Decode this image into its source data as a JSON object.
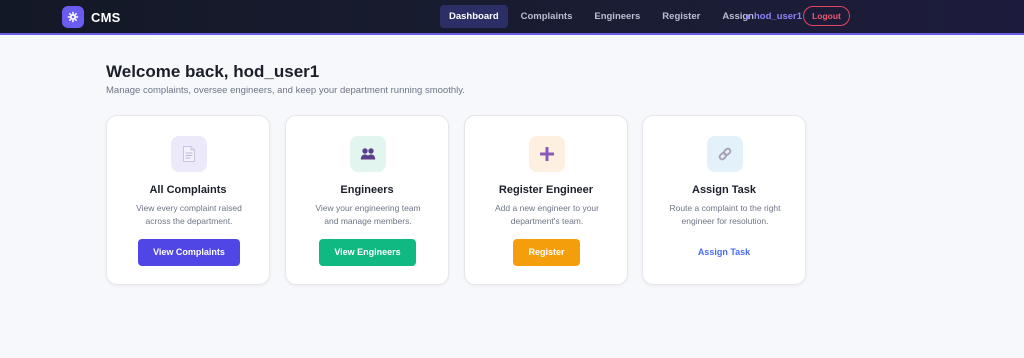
{
  "app": {
    "name": "CMS"
  },
  "nav": {
    "items": [
      {
        "label": "Dashboard"
      },
      {
        "label": "Complaints"
      },
      {
        "label": "Engineers"
      },
      {
        "label": "Register"
      },
      {
        "label": "Assign"
      }
    ],
    "active": "Dashboard",
    "user": "hod_user1",
    "logout_label": "Logout"
  },
  "header": {
    "title": "Welcome back, hod_user1",
    "subtitle": "Manage complaints, oversee engineers, and keep your department running smoothly."
  },
  "cards": [
    {
      "title": "All Complaints",
      "desc_line1": "View every complaint raised",
      "desc_line2": "across the department.",
      "action": "View Complaints",
      "icon": "document-icon",
      "color": "#4f46e5"
    },
    {
      "title": "Engineers",
      "desc_line1": "View your engineering team",
      "desc_line2": "and manage members.",
      "action": "View Engineers",
      "icon": "users-icon",
      "color": "#10b981"
    },
    {
      "title": "Register Engineer",
      "desc_line1": "Add a new engineer to your",
      "desc_line2": "department's team.",
      "action": "Register",
      "icon": "plus-icon",
      "color": "#f59e0b"
    },
    {
      "title": "Assign Task",
      "desc_line1": "Route a complaint to the right",
      "desc_line2": "engineer for resolution.",
      "action": "Assign Task",
      "icon": "link-icon",
      "color": "#4a6cf0"
    }
  ]
}
